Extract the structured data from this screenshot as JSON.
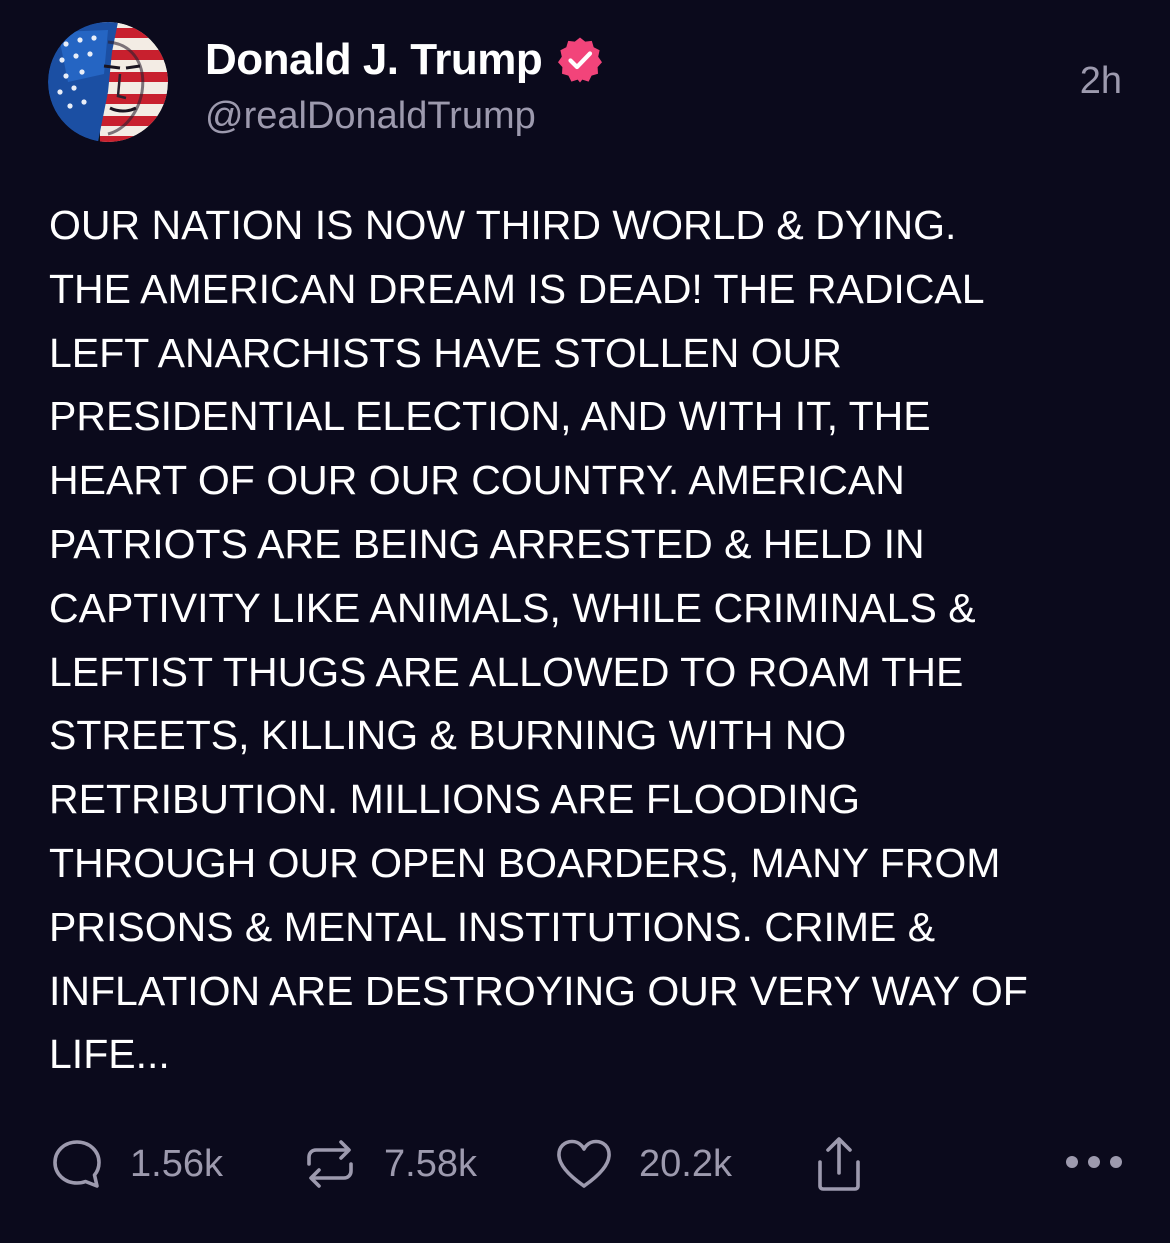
{
  "post": {
    "author": {
      "display_name": "Donald J. Trump",
      "handle": "@realDonaldTrump",
      "verified_icon": "verified-badge-icon",
      "verified_color": "#f2447a"
    },
    "timestamp": "2h",
    "text": "OUR NATION IS NOW THIRD WORLD & DYING.\nTHE AMERICAN DREAM IS DEAD! THE RADICAL\nLEFT ANARCHISTS HAVE STOLLEN OUR\nPRESIDENTIAL ELECTION, AND WITH IT, THE\nHEART OF OUR OUR COUNTRY. AMERICAN\nPATRIOTS ARE BEING ARRESTED & HELD IN\nCAPTIVITY LIKE ANIMALS, WHILE CRIMINALS &\nLEFTIST THUGS ARE ALLOWED TO ROAM THE\nSTREETS, KILLING & BURNING WITH NO\nRETRIBUTION. MILLIONS ARE FLOODING\nTHROUGH OUR OPEN BOARDERS, MANY FROM\nPRISONS & MENTAL INSTITUTIONS. CRIME &\nINFLATION ARE DESTROYING OUR VERY WAY OF\nLIFE...",
    "actions": {
      "replies": "1.56k",
      "reposts": "7.58k",
      "likes": "20.2k"
    }
  },
  "theme": {
    "background": "#0b0a1c",
    "text": "#ffffff",
    "secondary_text": "#9d9aae"
  }
}
